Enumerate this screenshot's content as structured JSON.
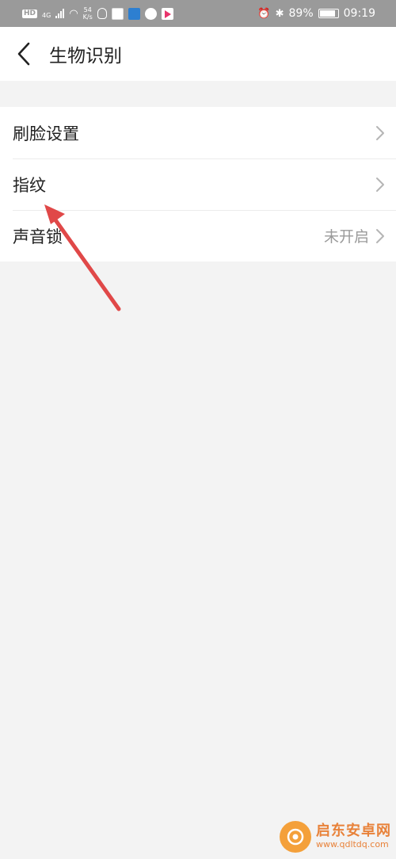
{
  "status_bar": {
    "network_badge": "HD",
    "network_type": "4G",
    "speed_value": "54",
    "speed_unit": "K/s",
    "battery_percent": "89%",
    "battery_level": 0.89,
    "time": "09:19",
    "app_icons": [
      "qq-icon",
      "app-icon-1",
      "app-icon-2",
      "app-icon-3",
      "video-app-icon"
    ]
  },
  "header": {
    "title": "生物识别",
    "back_icon": "chevron-left-icon"
  },
  "settings": {
    "items": [
      {
        "label": "刷脸设置",
        "value": ""
      },
      {
        "label": "指纹",
        "value": ""
      },
      {
        "label": "声音锁",
        "value": "未开启"
      }
    ]
  },
  "watermark": {
    "brand": "启东安卓网",
    "url": "www.qdltdq.com"
  },
  "colors": {
    "background": "#f3f3f3",
    "status_bar": "#9a9a9a",
    "annotation_arrow": "#e04848",
    "watermark": "#e8823a"
  }
}
